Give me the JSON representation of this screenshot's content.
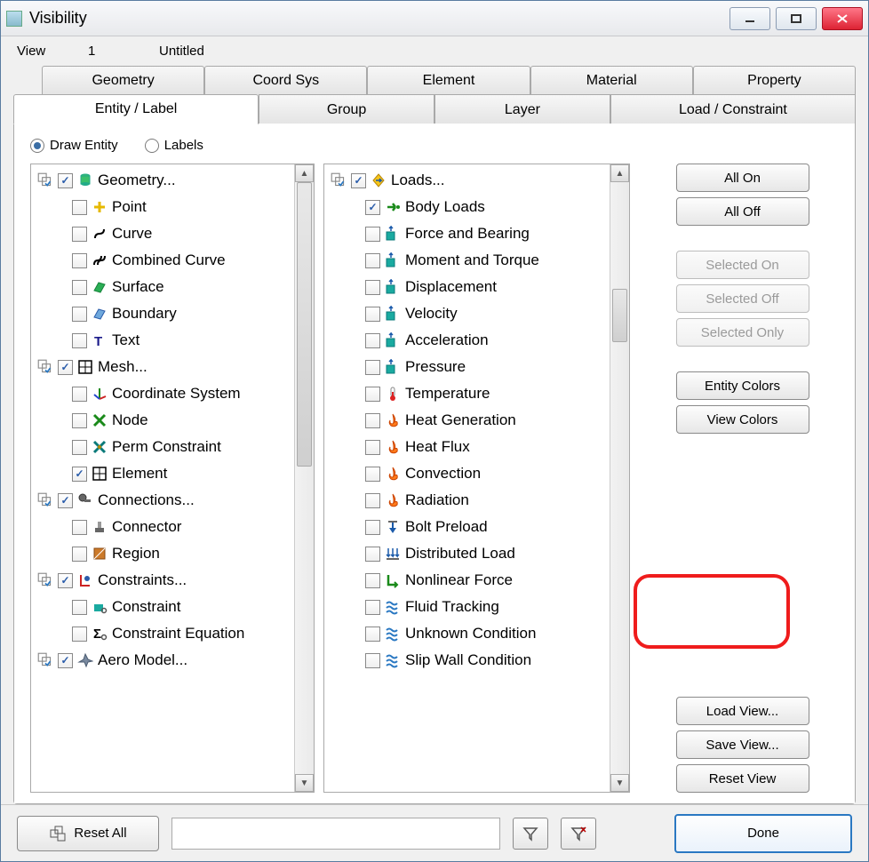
{
  "window": {
    "title": "Visibility"
  },
  "view": {
    "label": "View",
    "number": "1",
    "name": "Untitled"
  },
  "tabs_row1": [
    {
      "label": "Geometry"
    },
    {
      "label": "Coord Sys"
    },
    {
      "label": "Element"
    },
    {
      "label": "Material"
    },
    {
      "label": "Property"
    }
  ],
  "tabs_row2": [
    {
      "label": "Entity / Label",
      "active": true
    },
    {
      "label": "Group"
    },
    {
      "label": "Layer"
    },
    {
      "label": "Load / Constraint"
    }
  ],
  "radios": {
    "draw_entity": "Draw Entity",
    "labels": "Labels"
  },
  "left_tree": [
    {
      "type": "parent",
      "label": "Geometry...",
      "checked": true,
      "icon": "cylinder"
    },
    {
      "type": "child",
      "label": "Point",
      "checked": false,
      "icon": "plus-yellow"
    },
    {
      "type": "child",
      "label": "Curve",
      "checked": false,
      "icon": "s-curve"
    },
    {
      "type": "child",
      "label": "Combined Curve",
      "checked": false,
      "icon": "ss-curve"
    },
    {
      "type": "child",
      "label": "Surface",
      "checked": false,
      "icon": "surface"
    },
    {
      "type": "child",
      "label": "Boundary",
      "checked": false,
      "icon": "boundary"
    },
    {
      "type": "child",
      "label": "Text",
      "checked": false,
      "icon": "text-t"
    },
    {
      "type": "parent",
      "label": "Mesh...",
      "checked": true,
      "icon": "grid"
    },
    {
      "type": "child",
      "label": "Coordinate System",
      "checked": false,
      "icon": "axes"
    },
    {
      "type": "child",
      "label": "Node",
      "checked": false,
      "icon": "x-green"
    },
    {
      "type": "child",
      "label": "Perm Constraint",
      "checked": false,
      "icon": "x-teal"
    },
    {
      "type": "child",
      "label": "Element",
      "checked": true,
      "icon": "grid"
    },
    {
      "type": "parent",
      "label": "Connections...",
      "checked": true,
      "icon": "key"
    },
    {
      "type": "child",
      "label": "Connector",
      "checked": false,
      "icon": "connector"
    },
    {
      "type": "child",
      "label": "Region",
      "checked": false,
      "icon": "region"
    },
    {
      "type": "parent",
      "label": "Constraints...",
      "checked": true,
      "icon": "clamp"
    },
    {
      "type": "child",
      "label": "Constraint",
      "checked": false,
      "icon": "clamp-teal"
    },
    {
      "type": "child",
      "label": "Constraint Equation",
      "checked": false,
      "icon": "sigma"
    },
    {
      "type": "parent",
      "label": "Aero Model...",
      "checked": true,
      "icon": "plane"
    }
  ],
  "right_tree": [
    {
      "type": "parent",
      "label": "Loads...",
      "checked": true,
      "icon": "diamond-arrow"
    },
    {
      "type": "child",
      "label": "Body Loads",
      "checked": true,
      "icon": "arrow-green"
    },
    {
      "type": "child",
      "label": "Force and Bearing",
      "checked": false,
      "icon": "cube-arrow"
    },
    {
      "type": "child",
      "label": "Moment and Torque",
      "checked": false,
      "icon": "cube-arrow"
    },
    {
      "type": "child",
      "label": "Displacement",
      "checked": false,
      "icon": "cube-arrow"
    },
    {
      "type": "child",
      "label": "Velocity",
      "checked": false,
      "icon": "cube-arrow"
    },
    {
      "type": "child",
      "label": "Acceleration",
      "checked": false,
      "icon": "cube-arrow"
    },
    {
      "type": "child",
      "label": "Pressure",
      "checked": false,
      "icon": "cube-arrow"
    },
    {
      "type": "child",
      "label": "Temperature",
      "checked": false,
      "icon": "thermo"
    },
    {
      "type": "child",
      "label": "Heat Generation",
      "checked": false,
      "icon": "flame"
    },
    {
      "type": "child",
      "label": "Heat Flux",
      "checked": false,
      "icon": "flame"
    },
    {
      "type": "child",
      "label": "Convection",
      "checked": false,
      "icon": "flame"
    },
    {
      "type": "child",
      "label": "Radiation",
      "checked": false,
      "icon": "flame"
    },
    {
      "type": "child",
      "label": "Bolt Preload",
      "checked": false,
      "icon": "bolt"
    },
    {
      "type": "child",
      "label": "Distributed Load",
      "checked": false,
      "icon": "arrows-down"
    },
    {
      "type": "child",
      "label": "Nonlinear Force",
      "checked": false,
      "icon": "l-arrow"
    },
    {
      "type": "child",
      "label": "Fluid Tracking",
      "checked": false,
      "icon": "waves"
    },
    {
      "type": "child",
      "label": "Unknown Condition",
      "checked": false,
      "icon": "waves"
    },
    {
      "type": "child",
      "label": "Slip Wall Condition",
      "checked": false,
      "icon": "waves"
    }
  ],
  "side_buttons": {
    "all_on": "All On",
    "all_off": "All Off",
    "sel_on": "Selected On",
    "sel_off": "Selected Off",
    "sel_only": "Selected Only",
    "entity_colors": "Entity Colors",
    "view_colors": "View Colors",
    "load_view": "Load View...",
    "save_view": "Save View...",
    "reset_view": "Reset View"
  },
  "bottom": {
    "reset_all": "Reset All",
    "done": "Done"
  }
}
